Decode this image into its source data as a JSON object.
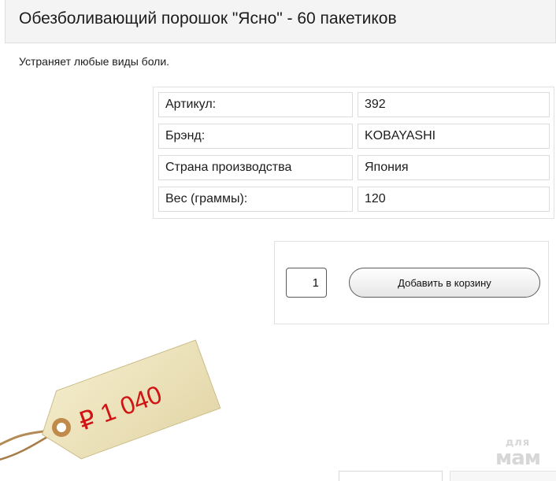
{
  "product": {
    "title": "Обезболивающий порошок \"Ясно\" - 60 пакетиков",
    "description": "Устраняет любые виды боли."
  },
  "specs": [
    {
      "key": "Артикул:",
      "value": "392"
    },
    {
      "key": "Брэнд:",
      "value": "KOBAYASHI"
    },
    {
      "key": "Страна производства",
      "value": "Япония"
    },
    {
      "key": "Вес (граммы):",
      "value": "120"
    }
  ],
  "cart": {
    "quantity": "1",
    "add_label": "Добавить в корзину"
  },
  "price": {
    "text": "₽ 1 040",
    "color": "#d01414"
  },
  "watermark": {
    "small": "для",
    "big": "мам"
  }
}
